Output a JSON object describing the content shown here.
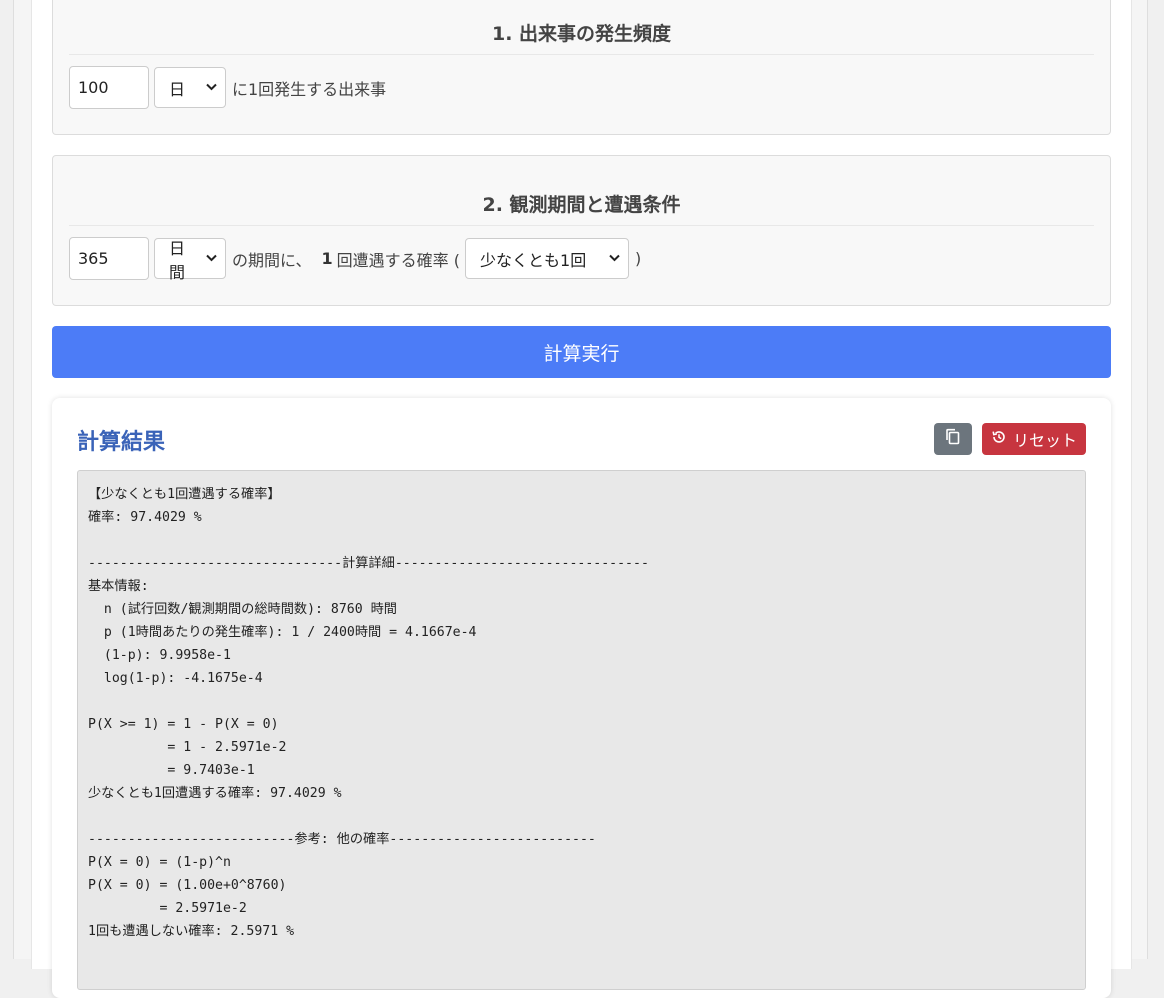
{
  "section1": {
    "title": "1. 出来事の発生頻度",
    "value": "100",
    "unit": "日",
    "suffix": "に1回発生する出来事"
  },
  "section2": {
    "title": "2. 観測期間と遭遇条件",
    "value": "365",
    "unit": "日間",
    "text_a": "の期間に、",
    "count": "1",
    "text_b": "回遭遇する確率 (",
    "condition": "少なくとも1回",
    "text_c": ")"
  },
  "calc_button": "計算実行",
  "result": {
    "title": "計算結果",
    "reset_label": "リセット",
    "output": "【少なくとも1回遭遇する確率】\n確率: 97.4029 %\n\n--------------------------------計算詳細--------------------------------\n基本情報:\n  n (試行回数/観測期間の総時間数): 8760 時間\n  p (1時間あたりの発生確率): 1 / 2400時間 = 4.1667e-4\n  (1-p): 9.9958e-1\n  log(1-p): -4.1675e-4\n\nP(X >= 1) = 1 - P(X = 0)\n          = 1 - 2.5971e-2\n          = 9.7403e-1\n少なくとも1回遭遇する確率: 97.4029 %\n\n--------------------------参考: 他の確率--------------------------\nP(X = 0) = (1-p)^n\nP(X = 0) = (1.00e+0^8760)\n         = 2.5971e-2\n1回も遭遇しない確率: 2.5971 %"
  },
  "colors": {
    "primary": "#4c7cf7",
    "danger": "#c7353f",
    "secondary": "#6c757d",
    "title_blue": "#3a63b8"
  },
  "icons": {
    "copy": "copy-icon",
    "reset": "history-icon",
    "dropdown": "chevron-down-icon"
  }
}
